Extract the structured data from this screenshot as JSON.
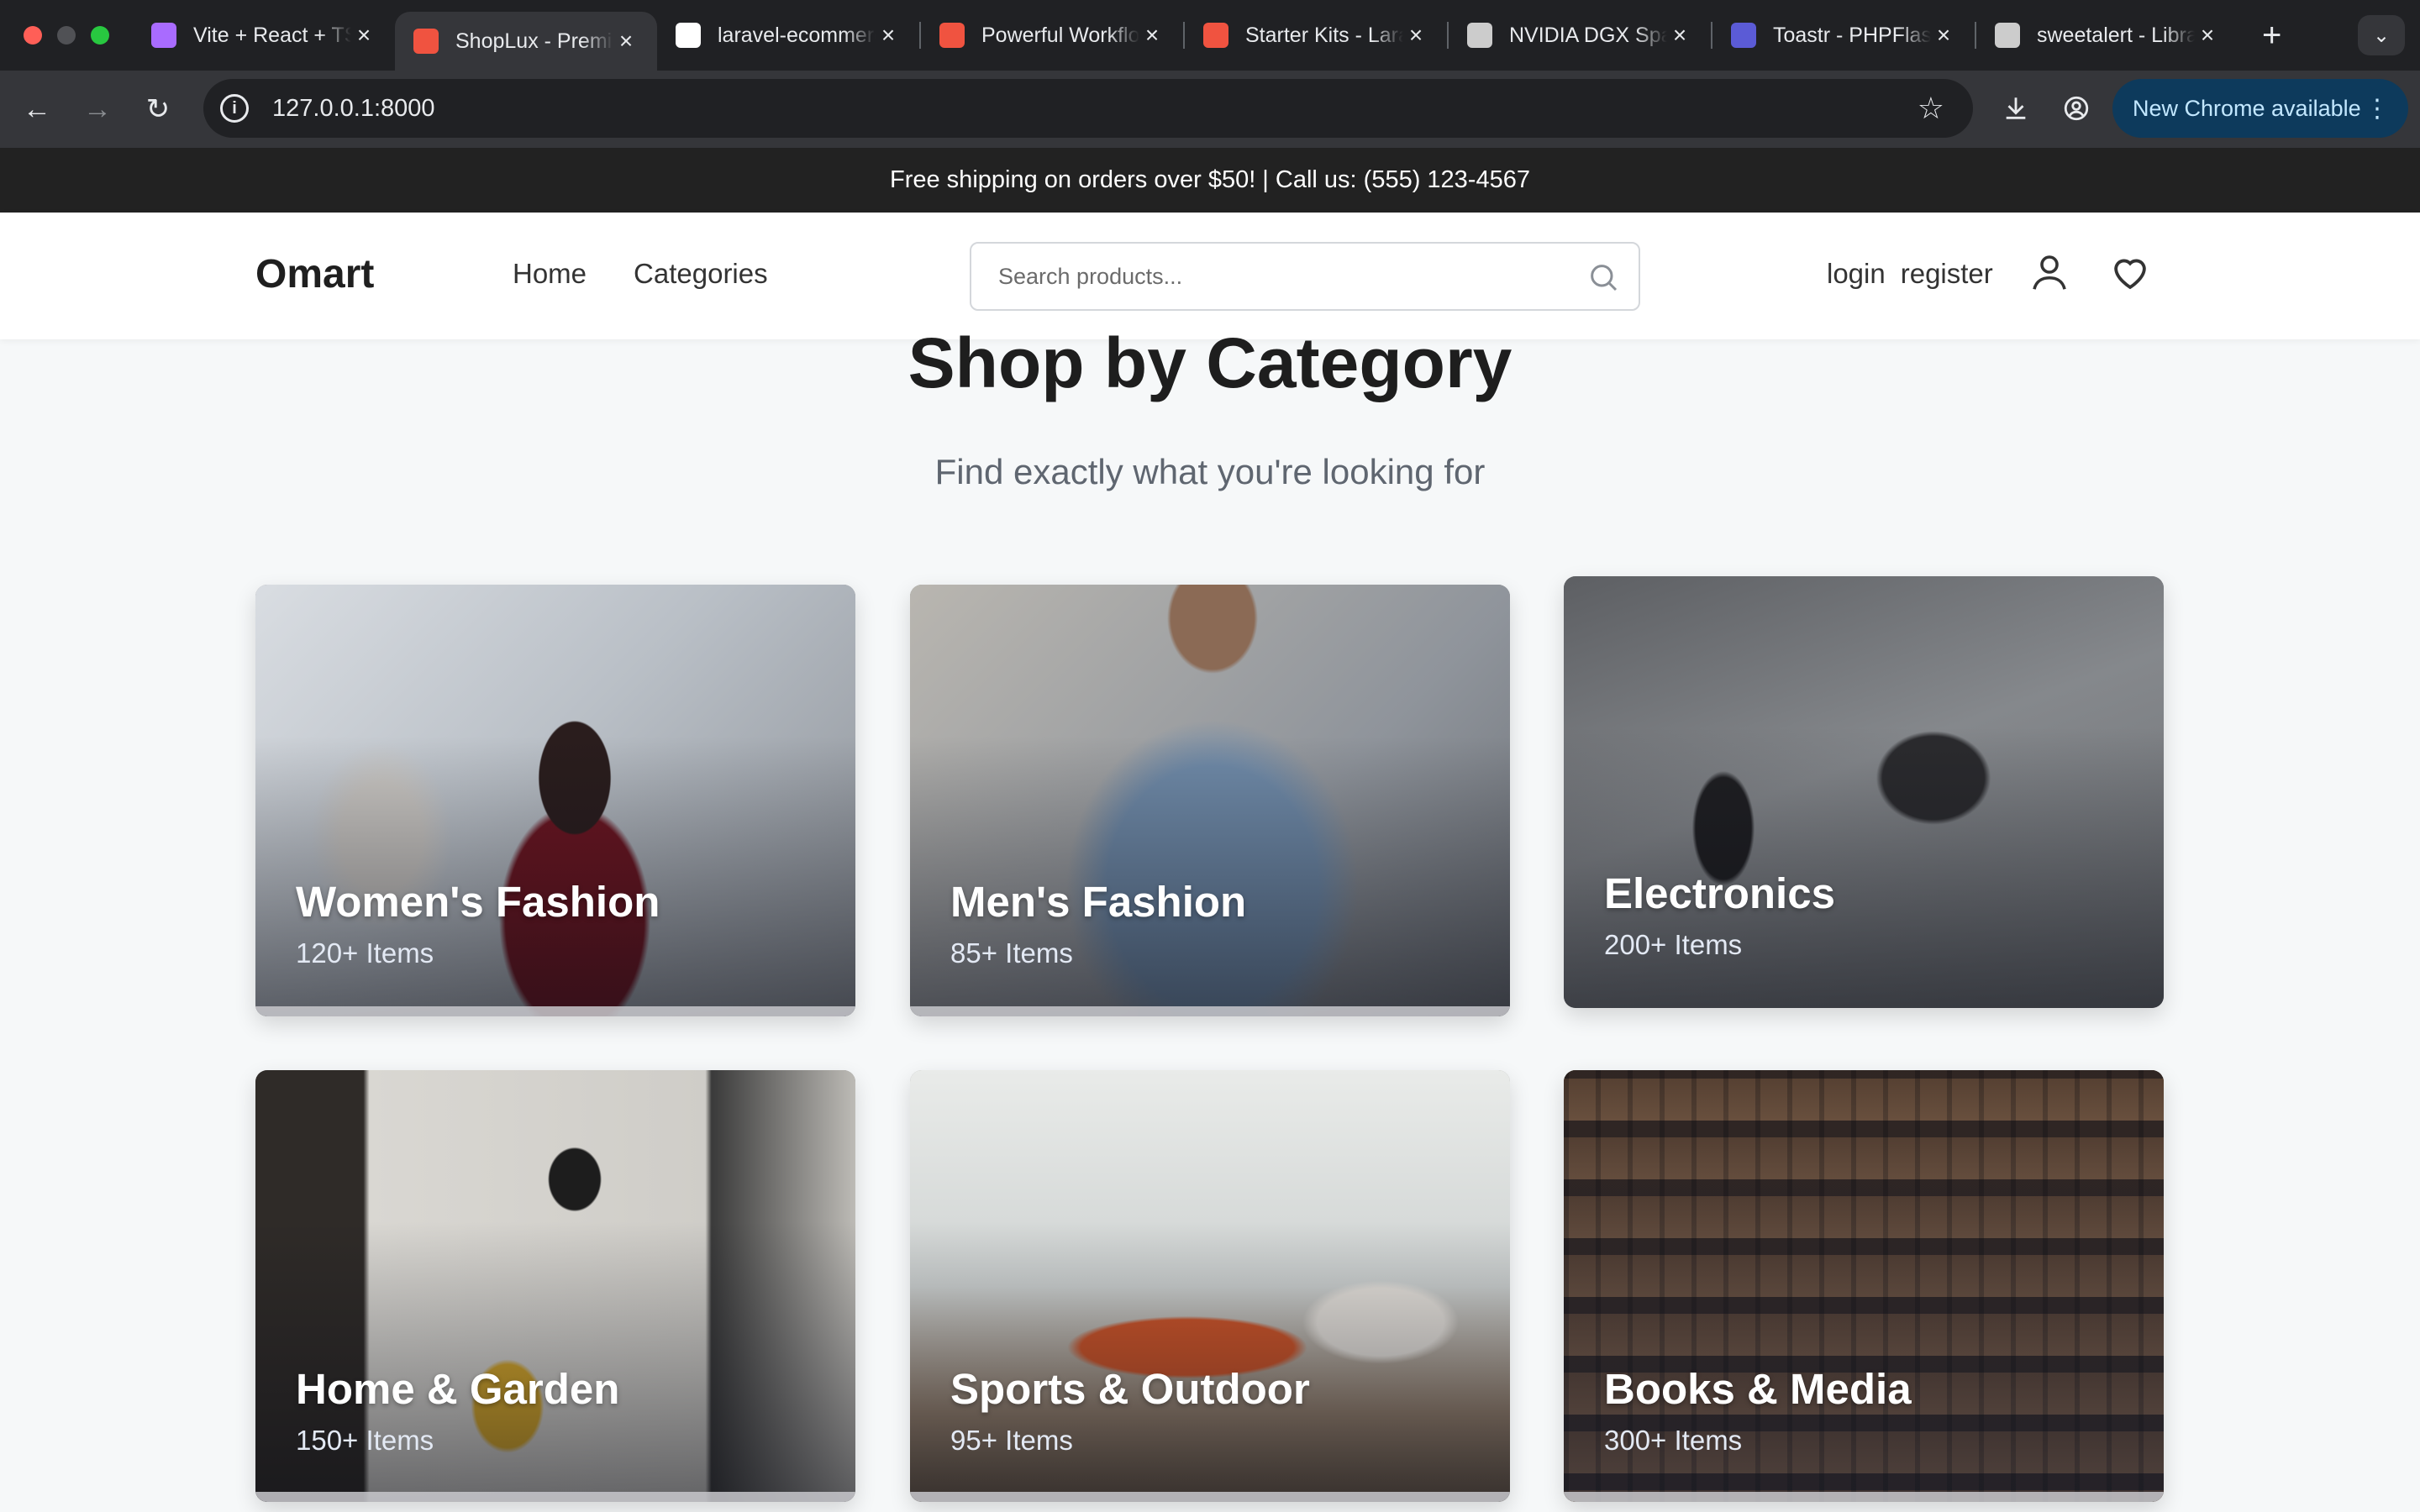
{
  "browser": {
    "tabs": [
      {
        "title": "Vite + React + TS",
        "active": false,
        "favicon_color": "#a96bff"
      },
      {
        "title": "ShopLux - Premium",
        "active": true,
        "favicon_color": "#f05340"
      },
      {
        "title": "laravel-ecommerce",
        "active": false,
        "favicon_color": "#ffffff"
      },
      {
        "title": "Powerful Workflow",
        "active": false,
        "favicon_color": "#f05340"
      },
      {
        "title": "Starter Kits - Laravel",
        "active": false,
        "favicon_color": "#f05340"
      },
      {
        "title": "NVIDIA DGX Spark",
        "active": false,
        "favicon_color": "#cccccc"
      },
      {
        "title": "Toastr - PHPFlasher",
        "active": false,
        "favicon_color": "#5b5bd6"
      },
      {
        "title": "sweetalert - Libraries",
        "active": false,
        "favicon_color": "#cccccc"
      }
    ],
    "new_tab_label": "+",
    "url": "127.0.0.1:8000",
    "update_label": "New Chrome available"
  },
  "announcement": "Free shipping on orders over $50! | Call us: (555) 123-4567",
  "header": {
    "logo": "Omart",
    "nav": [
      "Home",
      "Categories"
    ],
    "search_placeholder": "Search products...",
    "login": "login",
    "register": "register"
  },
  "section": {
    "title": "Shop by Category",
    "subtitle": "Find exactly what you're looking for"
  },
  "categories": [
    {
      "name": "Women's Fashion",
      "count": "120+ Items"
    },
    {
      "name": "Men's Fashion",
      "count": "85+ Items"
    },
    {
      "name": "Electronics",
      "count": "200+ Items"
    },
    {
      "name": "Home & Garden",
      "count": "150+ Items"
    },
    {
      "name": "Sports & Outdoor",
      "count": "95+ Items"
    },
    {
      "name": "Books & Media",
      "count": "300+ Items"
    }
  ],
  "colors": {
    "announcement_bg": "#222222",
    "page_bg": "#f6f8f9",
    "chrome_update_pill": "#0d3a5c"
  }
}
